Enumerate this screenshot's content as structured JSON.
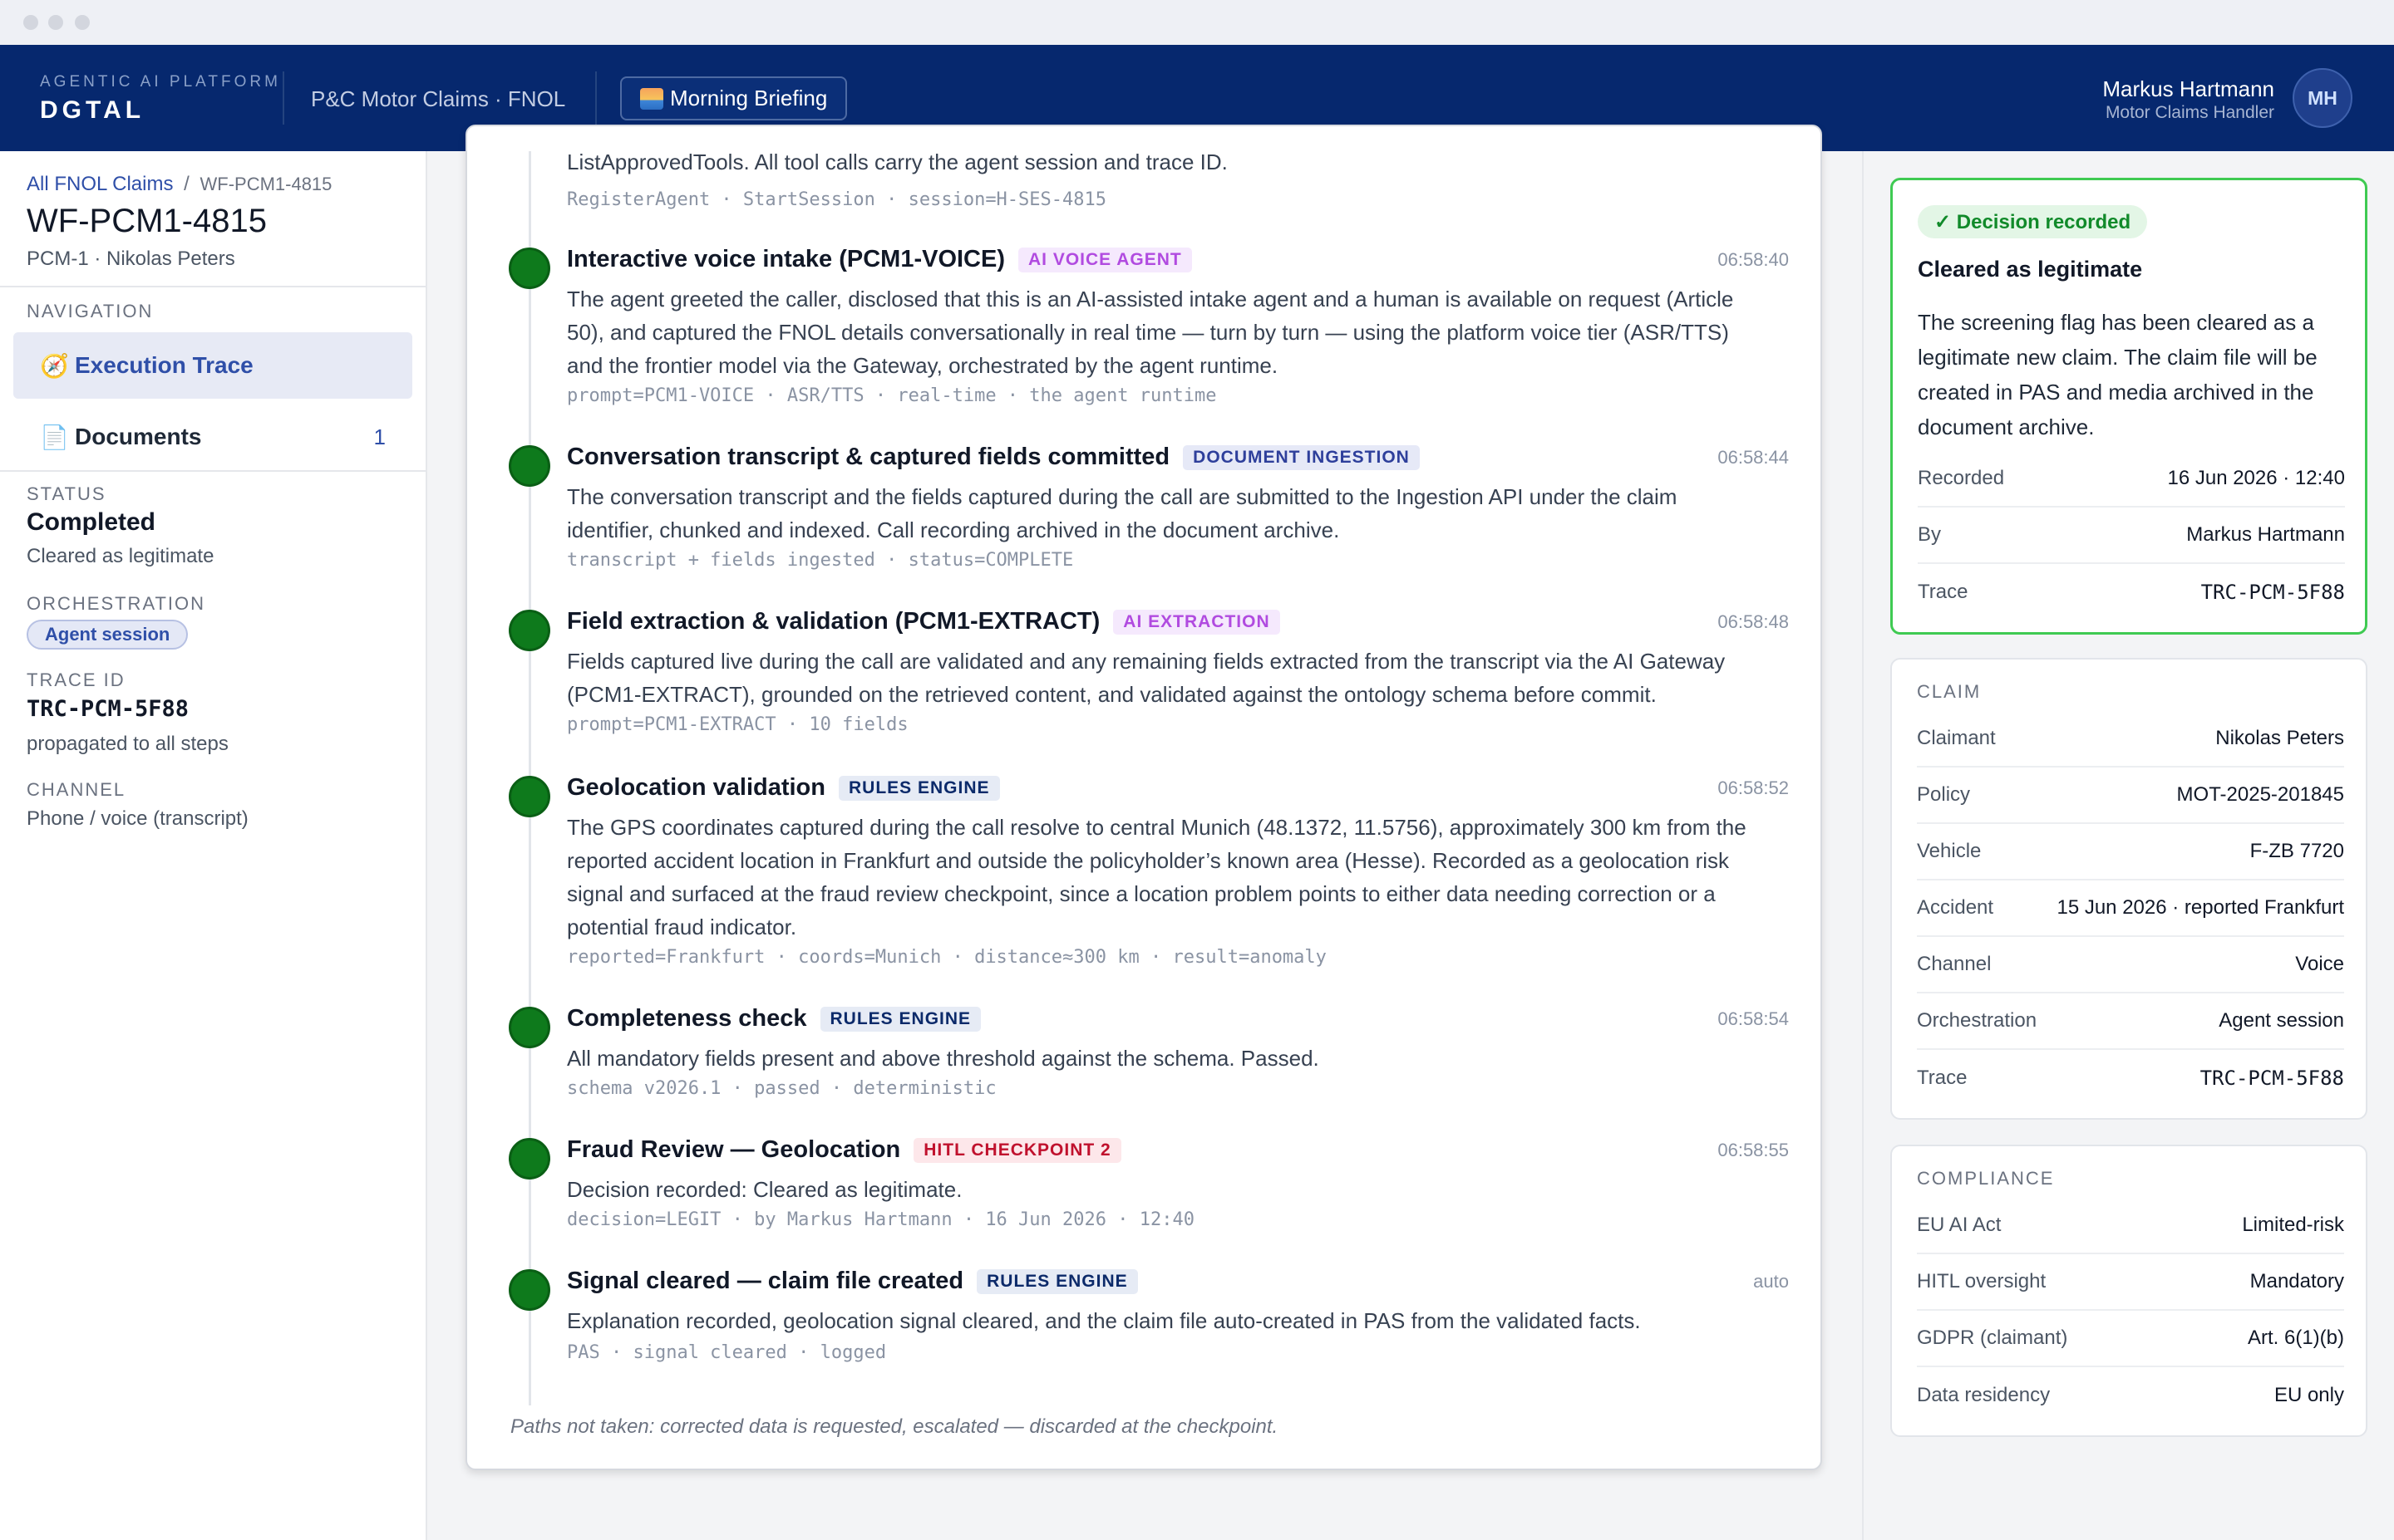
{
  "header": {
    "platform_label": "AGENTIC AI PLATFORM",
    "brand": "DGTAL",
    "context": "P&C Motor Claims · FNOL",
    "briefing_button": "Morning Briefing",
    "user_name": "Markus Hartmann",
    "user_role": "Motor Claims Handler",
    "avatar_initials": "MH"
  },
  "sidebar": {
    "breadcrumb_root": "All FNOL Claims",
    "breadcrumb_sep": "/",
    "breadcrumb_current": "WF-PCM1-4815",
    "title": "WF-PCM1-4815",
    "subtitle": "PCM-1 · Nikolas Peters",
    "navigation_label": "NAVIGATION",
    "nav_items": [
      {
        "label": "Execution Trace",
        "icon": "compass-icon",
        "active": true
      },
      {
        "label": "Documents",
        "icon": "document-icon",
        "count": "1"
      }
    ],
    "status_label": "STATUS",
    "status_value": "Completed",
    "status_detail": "Cleared as legitimate",
    "orchestration_label": "ORCHESTRATION",
    "orchestration_value": "Agent session",
    "trace_label": "TRACE ID",
    "trace_value": "TRC-PCM-5F88",
    "trace_detail": "propagated to all steps",
    "channel_label": "CHANNEL",
    "channel_value": "Phone / voice (transcript)"
  },
  "trace": {
    "previous_text": "ListApprovedTools. All tool calls carry the agent session and trace ID.",
    "previous_meta": "RegisterAgent · StartSession · session=H-SES-4815",
    "steps": [
      {
        "title": "Interactive voice intake (PCM1-VOICE)",
        "tag": "AI VOICE AGENT",
        "time": "06:58:40",
        "desc": "The agent greeted the caller, disclosed that this is an AI-assisted intake agent and a human is available on request (Article 50), and captured the FNOL details conversationally in real time — turn by turn — using the platform voice tier (ASR/TTS) and the frontier model via the Gateway, orchestrated by the agent runtime.",
        "meta": "prompt=PCM1-VOICE · ASR/TTS · real-time · the agent runtime"
      },
      {
        "title": "Conversation transcript & captured fields committed",
        "tag": "DOCUMENT INGESTION",
        "time": "06:58:44",
        "desc": "The conversation transcript and the fields captured during the call are submitted to the Ingestion API under the claim identifier, chunked and indexed. Call recording archived in the document archive.",
        "meta": "transcript + fields ingested · status=COMPLETE"
      },
      {
        "title": "Field extraction & validation (PCM1-EXTRACT)",
        "tag": "AI EXTRACTION",
        "time": "06:58:48",
        "desc": "Fields captured live during the call are validated and any remaining fields extracted from the transcript via the AI Gateway (PCM1-EXTRACT), grounded on the retrieved content, and validated against the ontology schema before commit.",
        "meta": "prompt=PCM1-EXTRACT · 10 fields"
      },
      {
        "title": "Geolocation validation",
        "tag": "RULES ENGINE",
        "time": "06:58:52",
        "desc": "The GPS coordinates captured during the call resolve to central Munich (48.1372, 11.5756), approximately 300 km from the reported accident location in Frankfurt and outside the policyholder’s known area (Hesse). Recorded as a geolocation risk signal and surfaced at the fraud review checkpoint, since a location problem points to either data needing correction or a potential fraud indicator.",
        "meta": "reported=Frankfurt · coords=Munich · distance≈300 km · result=anomaly"
      },
      {
        "title": "Completeness check",
        "tag": "RULES ENGINE",
        "time": "06:58:54",
        "desc": "All mandatory fields present and above threshold against the schema. Passed.",
        "meta": "schema v2026.1 · passed · deterministic"
      },
      {
        "title": "Fraud Review — Geolocation",
        "tag": "HITL CHECKPOINT 2",
        "time": "06:58:55",
        "desc": "Decision recorded: Cleared as legitimate.",
        "meta": "decision=LEGIT · by Markus Hartmann · 16 Jun 2026 · 12:40"
      },
      {
        "title": "Signal cleared — claim file created",
        "tag": "RULES ENGINE",
        "time": "auto",
        "desc": "Explanation recorded, geolocation signal cleared, and the claim file auto-created in PAS from the validated facts.",
        "meta": "PAS · signal cleared · logged"
      }
    ],
    "footnote": "Paths not taken: corrected data is requested, escalated — discarded at the checkpoint."
  },
  "decision": {
    "badge": "✓ Decision recorded",
    "title": "Cleared as legitimate",
    "body": "The screening flag has been cleared as a legitimate new claim. The claim file will be created in PAS and media archived in the document archive.",
    "rows": [
      {
        "k": "Recorded",
        "v": "16 Jun 2026 · 12:40"
      },
      {
        "k": "By",
        "v": "Markus Hartmann"
      },
      {
        "k": "Trace",
        "v": "TRC-PCM-5F88"
      }
    ]
  },
  "claim": {
    "label": "CLAIM",
    "rows": [
      {
        "k": "Claimant",
        "v": "Nikolas Peters"
      },
      {
        "k": "Policy",
        "v": "MOT-2025-201845"
      },
      {
        "k": "Vehicle",
        "v": "F-ZB 7720"
      },
      {
        "k": "Accident",
        "v": "15 Jun 2026 · reported Frankfurt"
      },
      {
        "k": "Channel",
        "v": "Voice"
      },
      {
        "k": "Orchestration",
        "v": "Agent session"
      },
      {
        "k": "Trace",
        "v": "TRC-PCM-5F88"
      }
    ]
  },
  "compliance": {
    "label": "COMPLIANCE",
    "rows": [
      {
        "k": "EU AI Act",
        "v": "Limited-risk"
      },
      {
        "k": "HITL oversight",
        "v": "Mandatory"
      },
      {
        "k": "GDPR (claimant)",
        "v": "Art. 6(1)(b)"
      },
      {
        "k": "Data residency",
        "v": "EU only"
      }
    ]
  },
  "colors": {
    "header_bg": "#06286e",
    "accent": "#2f4fa8",
    "step_dot": "#0e7a1c",
    "decision_border": "#3fca52"
  }
}
